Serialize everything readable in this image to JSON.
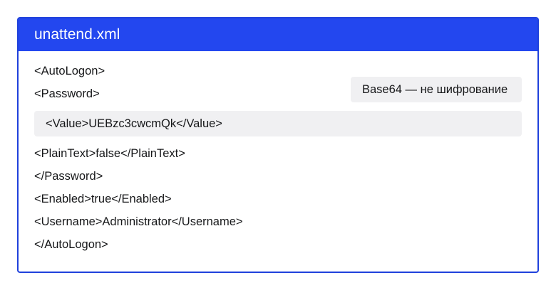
{
  "file": {
    "title": "unattend.xml"
  },
  "code": {
    "lines": [
      "<AutoLogon>",
      "<Password>",
      "<Value>UEBzc3cwcmQk</Value>",
      "<PlainText>false</PlainText>",
      "</Password>",
      "<Enabled>true</Enabled>",
      "<Username>Administrator</Username>",
      "</AutoLogon>"
    ]
  },
  "annotation": {
    "text": "Base64 — не шифрование"
  },
  "colors": {
    "accent": "#2347ef",
    "border": "#1f41dc",
    "highlight_bg": "#f0f0f2",
    "text": "#17181a"
  }
}
